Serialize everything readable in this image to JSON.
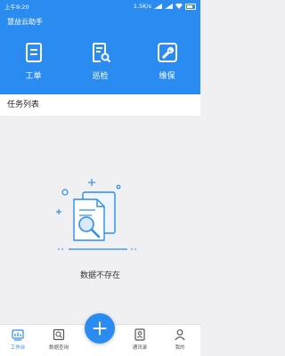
{
  "status_bar": {
    "time": "上午9:20",
    "network_speed": "1.5K/s"
  },
  "app": {
    "title": "慧益云助手"
  },
  "quick_actions": [
    {
      "label": "工单",
      "icon": "work-order-icon"
    },
    {
      "label": "巡检",
      "icon": "inspection-icon"
    },
    {
      "label": "维保",
      "icon": "maintenance-icon"
    }
  ],
  "task_list": {
    "title": "任务列表",
    "empty_text": "数据不存在"
  },
  "tab_bar": {
    "items": [
      {
        "label": "工作台",
        "icon": "workbench-icon",
        "active": true
      },
      {
        "label": "数据查询",
        "icon": "data-query-icon",
        "active": false
      },
      {
        "label": "通讯录",
        "icon": "contacts-icon",
        "active": false
      },
      {
        "label": "我的",
        "icon": "profile-icon",
        "active": false
      }
    ],
    "fab_icon": "plus-icon"
  },
  "colors": {
    "primary": "#2a8cf0",
    "background": "#f0f0f2",
    "white": "#ffffff"
  }
}
